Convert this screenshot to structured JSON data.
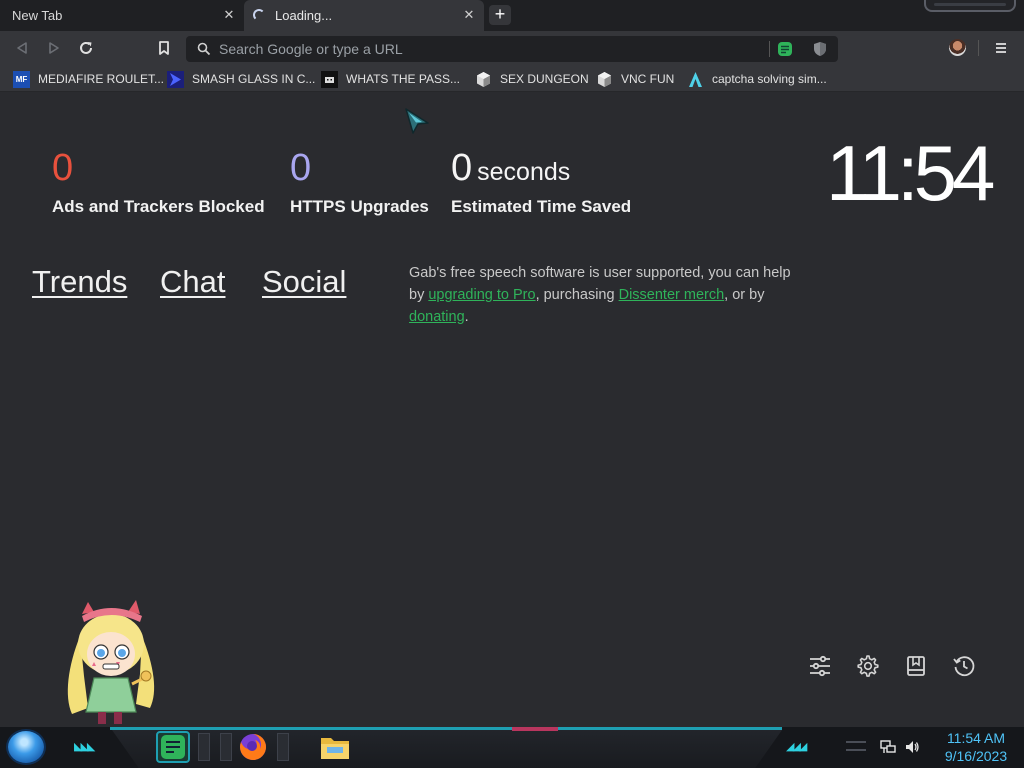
{
  "tabs": [
    {
      "label": "New Tab"
    },
    {
      "label": "Loading..."
    }
  ],
  "toolbar": {
    "omnibox_placeholder": "Search Google or type a URL"
  },
  "bookmarks": [
    {
      "label": "MEDIAFIRE ROULET...",
      "icon": "mediafire-icon"
    },
    {
      "label": "SMASH GLASS IN C...",
      "icon": "chevron-logo-icon"
    },
    {
      "label": "WHATS THE PASS...",
      "icon": "robot-icon"
    },
    {
      "label": "SEX DUNGEON",
      "icon": "cube-icon"
    },
    {
      "label": "VNC FUN",
      "icon": "cube-icon"
    },
    {
      "label": "captcha solving sim...",
      "icon": "arch-logo-icon"
    }
  ],
  "stats": {
    "ads_count": "0",
    "ads_label": "Ads and Trackers Blocked",
    "https_count": "0",
    "https_label": "HTTPS Upgrades",
    "time_count": "0",
    "time_unit": "seconds",
    "time_label": "Estimated Time Saved"
  },
  "clock": "11:54",
  "links": {
    "trends": "Trends",
    "chat": "Chat",
    "social": "Social"
  },
  "gab": {
    "text_1": "Gab's free speech software is user supported, you can help by ",
    "link_pro": "upgrading to Pro",
    "text_2": ", purchasing ",
    "link_merch": "Dissenter merch",
    "text_3": ", or by ",
    "link_donate": "donating",
    "text_4": "."
  },
  "colors": {
    "ads_count": "#e8513d",
    "https_count": "#a9a6f0",
    "gab_link": "#2fb35a",
    "tray_text": "#4fc3f7"
  },
  "taskbar": {
    "time": "11:54 AM",
    "date": "9/16/2023"
  }
}
